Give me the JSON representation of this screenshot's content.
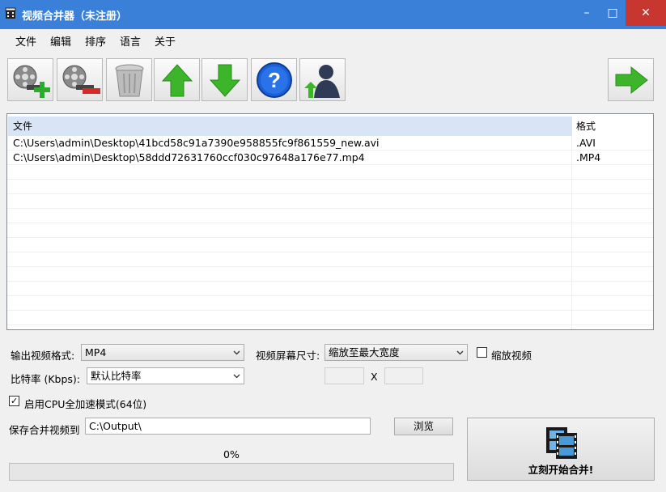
{
  "window": {
    "title": "视频合并器（未注册）",
    "controls": {
      "minimize": "–",
      "maximize": "□",
      "close": "✕"
    }
  },
  "menu": [
    "文件",
    "编辑",
    "排序",
    "语言",
    "关于"
  ],
  "toolbar": {
    "buttons": [
      {
        "name": "add-file-button",
        "icon": "film-reel-add-icon"
      },
      {
        "name": "remove-file-button",
        "icon": "film-reel-remove-icon"
      },
      {
        "name": "clear-list-button",
        "icon": "trash-bin-icon"
      },
      {
        "name": "move-up-button",
        "icon": "arrow-up-icon"
      },
      {
        "name": "move-down-button",
        "icon": "arrow-down-icon"
      },
      {
        "name": "help-button",
        "icon": "help-question-icon"
      },
      {
        "name": "account-button",
        "icon": "user-upgrade-icon"
      },
      {
        "name": "next-button",
        "icon": "arrow-right-icon"
      }
    ]
  },
  "filelist": {
    "col_file": "文件",
    "col_format": "格式",
    "rows": [
      {
        "path": "C:\\Users\\admin\\Desktop\\41bcd58c91a7390e958855fc9f861559_new.avi",
        "format": ".AVI"
      },
      {
        "path": "C:\\Users\\admin\\Desktop\\58ddd72631760ccf030c97648a176e77.mp4",
        "format": ".MP4"
      }
    ]
  },
  "options": {
    "output_format_label": "输出视频格式:",
    "output_format_value": "MP4",
    "screen_size_label": "视频屏幕尺寸:",
    "screen_size_value": "缩放至最大宽度",
    "scale_video_label": "缩放视频",
    "scale_video_checked": false,
    "bitrate_label": "比特率 (Kbps):",
    "bitrate_value": "默认比特率",
    "size_separator": "X",
    "cpu_accel_label": "启用CPU全加速模式(64位)",
    "cpu_accel_checked": true,
    "save_to_label": "保存合并视频到",
    "save_to_value": "C:\\Output\\",
    "browse_label": "浏览"
  },
  "progress": {
    "text": "0%",
    "value": 0
  },
  "start_button": {
    "label": "立刻开始合并!"
  },
  "colors": {
    "titlebar": "#3a80d8",
    "close": "#c7372f",
    "header_highlight": "#d7e5f6",
    "arrow_green": "#3cb52a"
  }
}
